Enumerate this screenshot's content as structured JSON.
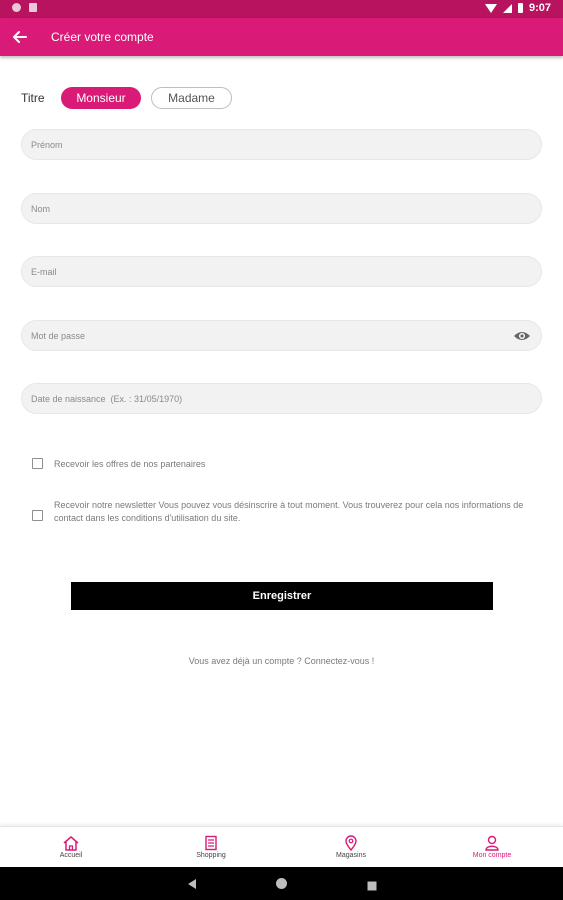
{
  "status_bar": {
    "time": "9:07"
  },
  "app_bar": {
    "title": "Créer votre compte"
  },
  "form": {
    "titre_label": "Titre",
    "titles": [
      "Monsieur",
      "Madame"
    ],
    "fields": {
      "prenom": {
        "placeholder": "Prénom",
        "value": ""
      },
      "nom": {
        "placeholder": "Nom",
        "value": ""
      },
      "email": {
        "placeholder": "E-mail",
        "value": ""
      },
      "password": {
        "placeholder": "Mot de passe",
        "value": ""
      },
      "birthdate": {
        "placeholder": "Date de naissance  (Ex. : 31/05/1970)",
        "value": ""
      }
    },
    "checkboxes": [
      {
        "label": "Recevoir les offres de nos partenaires",
        "checked": false
      },
      {
        "label": "Recevoir notre newsletter Vous pouvez vous désinscrire à tout moment. Vous trouverez pour cela nos informations de contact dans les conditions d'utilisation du site.",
        "checked": false
      }
    ],
    "submit_label": "Enregistrer",
    "login_prompt": "Vous avez déjà un compte ? Connectez-vous !"
  },
  "bottom_nav": {
    "items": [
      {
        "label": "Accueil",
        "icon": "home-icon"
      },
      {
        "label": "Shopping",
        "icon": "shopping-icon"
      },
      {
        "label": "Magasins",
        "icon": "location-pin-icon"
      },
      {
        "label": "Mon compte",
        "icon": "user-icon",
        "active": true
      }
    ]
  },
  "colors": {
    "primary": "#d91a77",
    "status_bar": "#b8135f",
    "button": "#000000"
  }
}
